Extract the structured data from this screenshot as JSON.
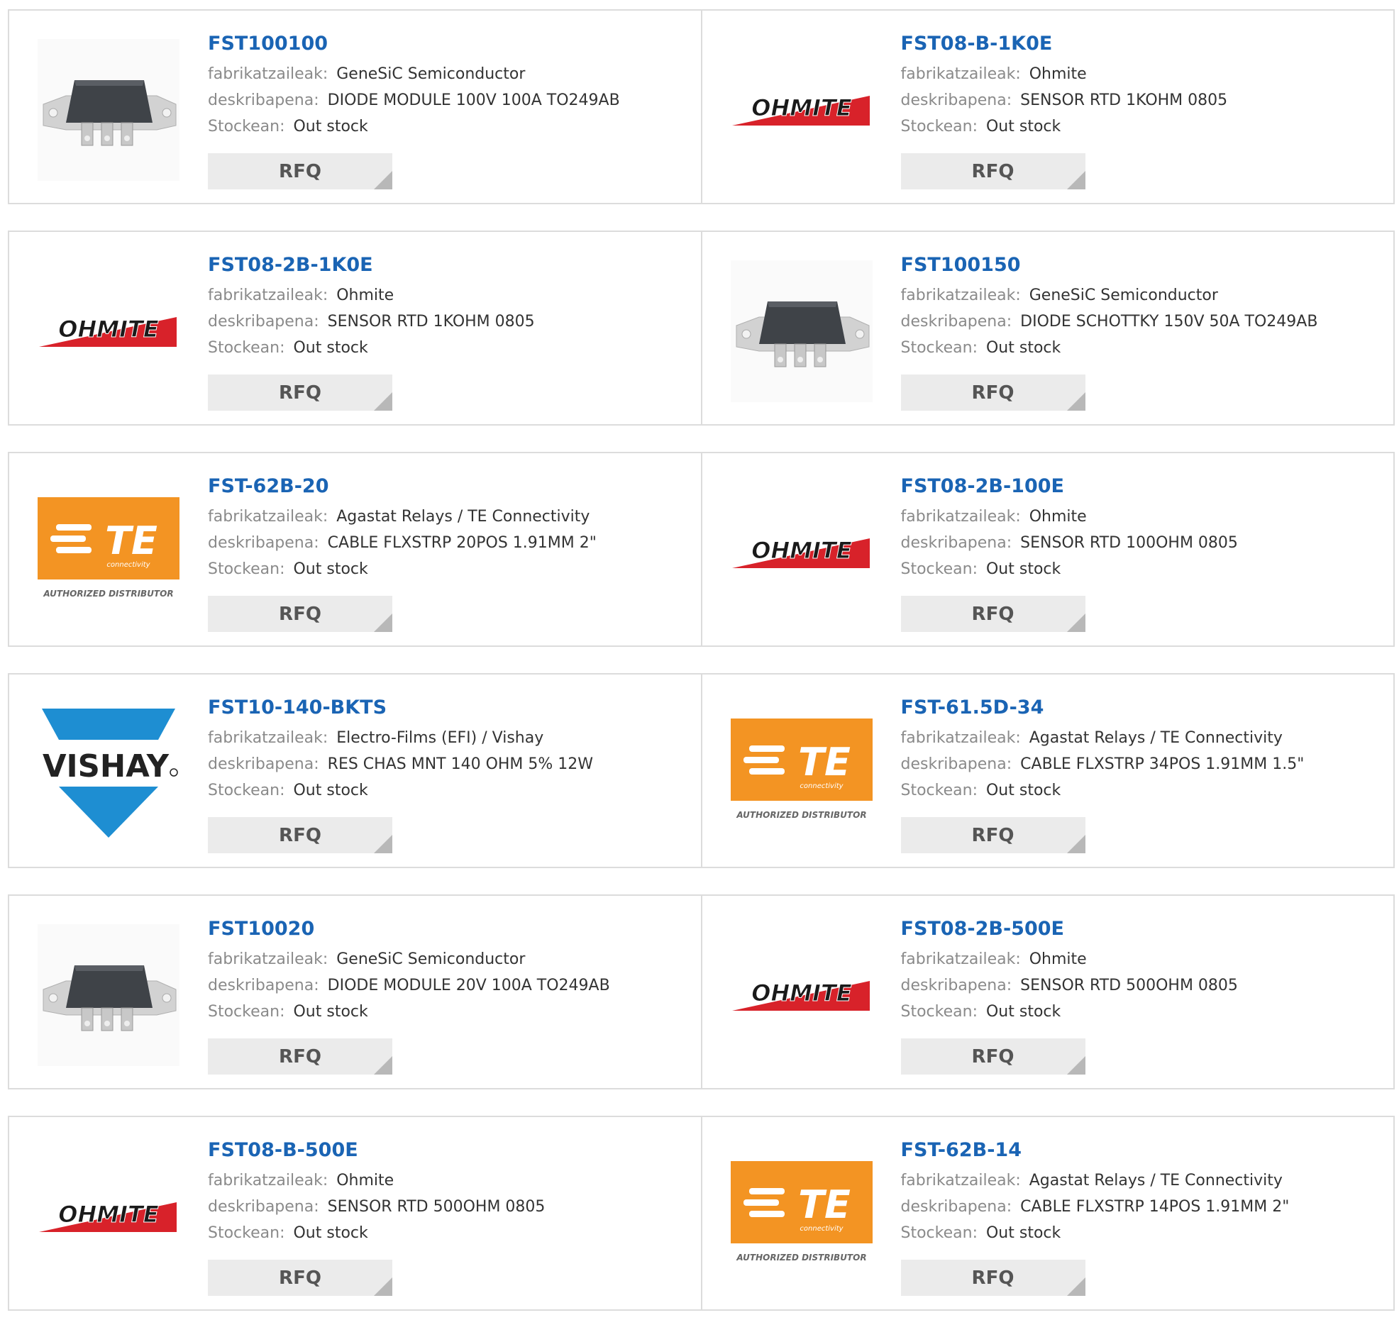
{
  "labels": {
    "manufacturer": "fabrikatzaileak:",
    "description": "deskribapena:",
    "stock": "Stockean:",
    "rfq": "RFQ"
  },
  "logos": {
    "ohmite": "OHMITE",
    "vishay": "VISHAY",
    "te": "TE",
    "te_sub": "connectivity",
    "te_tag": "AUTHORIZED DISTRIBUTOR"
  },
  "colors": {
    "part_link": "#1a64b4",
    "te_orange": "#f39423",
    "ohmite_red": "#d8222a",
    "vishay_blue": "#1e8ed2"
  },
  "products": [
    {
      "part": "FST100100",
      "manufacturer": "GeneSiC Semiconductor",
      "description": "DIODE MODULE 100V 100A TO249AB",
      "stock": "Out stock",
      "image": "module"
    },
    {
      "part": "FST08-B-1K0E",
      "manufacturer": "Ohmite",
      "description": "SENSOR RTD 1KOHM 0805",
      "stock": "Out stock",
      "image": "ohmite"
    },
    {
      "part": "FST08-2B-1K0E",
      "manufacturer": "Ohmite",
      "description": "SENSOR RTD 1KOHM 0805",
      "stock": "Out stock",
      "image": "ohmite"
    },
    {
      "part": "FST100150",
      "manufacturer": "GeneSiC Semiconductor",
      "description": "DIODE SCHOTTKY 150V 50A TO249AB",
      "stock": "Out stock",
      "image": "module"
    },
    {
      "part": "FST-62B-20",
      "manufacturer": "Agastat Relays / TE Connectivity",
      "description": "CABLE FLXSTRP 20POS 1.91MM 2\"",
      "stock": "Out stock",
      "image": "te"
    },
    {
      "part": "FST08-2B-100E",
      "manufacturer": "Ohmite",
      "description": "SENSOR RTD 100OHM 0805",
      "stock": "Out stock",
      "image": "ohmite"
    },
    {
      "part": "FST10-140-BKTS",
      "manufacturer": "Electro-Films (EFI) / Vishay",
      "description": "RES CHAS MNT 140 OHM 5% 12W",
      "stock": "Out stock",
      "image": "vishay"
    },
    {
      "part": "FST-61.5D-34",
      "manufacturer": "Agastat Relays / TE Connectivity",
      "description": "CABLE FLXSTRP 34POS 1.91MM 1.5\"",
      "stock": "Out stock",
      "image": "te"
    },
    {
      "part": "FST10020",
      "manufacturer": "GeneSiC Semiconductor",
      "description": "DIODE MODULE 20V 100A TO249AB",
      "stock": "Out stock",
      "image": "module"
    },
    {
      "part": "FST08-2B-500E",
      "manufacturer": "Ohmite",
      "description": "SENSOR RTD 500OHM 0805",
      "stock": "Out stock",
      "image": "ohmite"
    },
    {
      "part": "FST08-B-500E",
      "manufacturer": "Ohmite",
      "description": "SENSOR RTD 500OHM 0805",
      "stock": "Out stock",
      "image": "ohmite"
    },
    {
      "part": "FST-62B-14",
      "manufacturer": "Agastat Relays / TE Connectivity",
      "description": "CABLE FLXSTRP 14POS 1.91MM 2\"",
      "stock": "Out stock",
      "image": "te"
    }
  ]
}
